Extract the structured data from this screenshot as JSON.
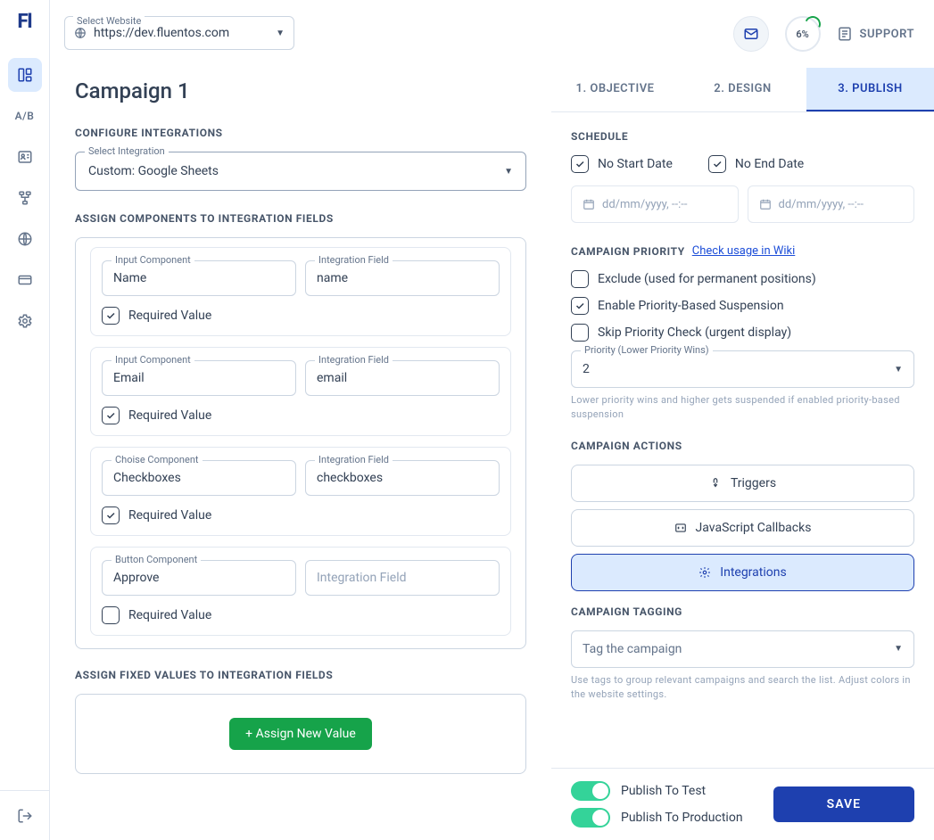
{
  "logo": "Fl",
  "topbar": {
    "select_website_label": "Select Website",
    "website": "https://dev.fluentos.com",
    "progress": "6%",
    "support": "SUPPORT"
  },
  "left": {
    "title": "Campaign 1",
    "config_title": "CONFIGURE INTEGRATIONS",
    "select_integration_label": "Select Integration",
    "select_integration_value": "Custom: Google Sheets",
    "assign_comp_title": "ASSIGN COMPONENTS TO INTEGRATION FIELDS",
    "labels": {
      "input_component": "Input Component",
      "choise_component": "Choise Component",
      "button_component": "Button Component",
      "integration_field": "Integration Field",
      "integration_field_ph": "Integration Field",
      "required_value": "Required Value"
    },
    "rows": [
      {
        "left_label_key": "input_component",
        "left_value": "Name",
        "right_value": "name",
        "required": true
      },
      {
        "left_label_key": "input_component",
        "left_value": "Email",
        "right_value": "email",
        "required": true
      },
      {
        "left_label_key": "choise_component",
        "left_value": "Checkboxes",
        "right_value": "checkboxes",
        "required": true
      },
      {
        "left_label_key": "button_component",
        "left_value": "Approve",
        "right_value": "",
        "required": false
      }
    ],
    "assign_fixed_title": "ASSIGN FIXED VALUES TO INTEGRATION FIELDS",
    "assign_btn": "+ Assign New Value"
  },
  "tabs": [
    {
      "label": "1. OBJECTIVE",
      "active": false
    },
    {
      "label": "2. DESIGN",
      "active": false
    },
    {
      "label": "3. PUBLISH",
      "active": true
    }
  ],
  "right": {
    "schedule_title": "SCHEDULE",
    "no_start": "No Start Date",
    "no_end": "No End Date",
    "date_ph": "dd/mm/yyyy, --:--",
    "priority_title": "CAMPAIGN PRIORITY",
    "wiki_link": "Check usage in Wiki",
    "exclude": "Exclude (used for permanent positions)",
    "enable_prio": "Enable Priority-Based Suspension",
    "skip_prio": "Skip Priority Check (urgent display)",
    "prio_label": "Priority (Lower Priority Wins)",
    "prio_value": "2",
    "prio_help": "Lower priority wins and higher gets suspended if enabled priority-based suspension",
    "actions_title": "CAMPAIGN ACTIONS",
    "triggers": "Triggers",
    "js_callbacks": "JavaScript Callbacks",
    "integrations": "Integrations",
    "tagging_title": "CAMPAIGN TAGGING",
    "tag_ph": "Tag the campaign",
    "tag_help": "Use tags to group relevant campaigns and search the list. Adjust colors in the website settings.",
    "publish_test": "Publish To Test",
    "publish_prod": "Publish To Production",
    "save": "SAVE"
  }
}
